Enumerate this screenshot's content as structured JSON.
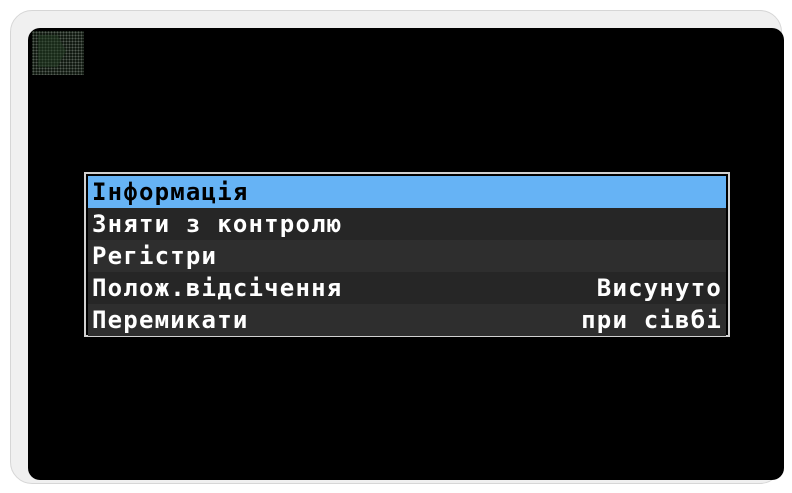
{
  "menu": {
    "items": [
      {
        "label": "Інформація",
        "value": "",
        "selected": true
      },
      {
        "label": "Зняти з контролю",
        "value": "",
        "selected": false
      },
      {
        "label": "Регістри",
        "value": "",
        "selected": false
      },
      {
        "label": "Полож.відсічення",
        "value": "Висунуто",
        "selected": false
      },
      {
        "label": "Перемикати",
        "value": "при сівбі",
        "selected": false
      }
    ]
  },
  "status": {
    "icon": "status-indicator-icon"
  },
  "colors": {
    "selection": "#66b3f5",
    "screen_background": "#000000",
    "text": "#ffffff"
  }
}
